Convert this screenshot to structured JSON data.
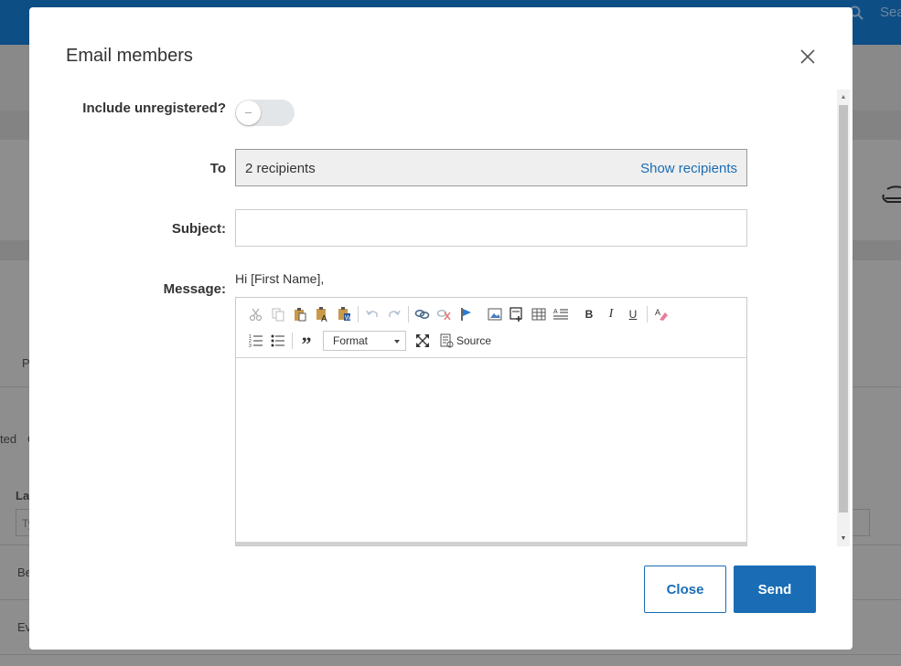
{
  "background": {
    "search_text": "Sea",
    "tab_fragment": "P",
    "filter_fragment_1": "ted",
    "filter_fragment_2": "C",
    "column_fragment": "Las",
    "input_fragment": "Ty",
    "row1_fragment": "Be",
    "row2_fragment": "Ev"
  },
  "modal": {
    "title": "Email members",
    "include_unregistered_label": "Include unregistered?",
    "toggle_state": "off",
    "to_label": "To",
    "recipients_count": "2 recipients",
    "show_recipients_link": "Show recipients",
    "subject_label": "Subject:",
    "subject_value": "",
    "message_label": "Message:",
    "message_greeting": "Hi [First Name],",
    "editor": {
      "toolbar_row1": [
        "cut-icon",
        "copy-icon",
        "paste-icon",
        "paste-text-icon",
        "paste-word-icon",
        "undo-icon",
        "redo-icon",
        "link-icon",
        "unlink-icon",
        "anchor-icon",
        "image-icon",
        "embed-icon",
        "table-icon",
        "text-indent-icon",
        "bold",
        "italic",
        "underline",
        "remove-format-icon"
      ],
      "toolbar_row2": [
        "numbered-list-icon",
        "bullet-list-icon",
        "blockquote-icon",
        "format-dropdown",
        "maximize-icon",
        "source-icon"
      ],
      "bold_label": "B",
      "italic_label": "I",
      "underline_label": "U",
      "blockquote_label": "”",
      "format_label": "Format",
      "source_label": "Source",
      "body_text": ""
    },
    "close_button": "Close",
    "send_button": "Send"
  },
  "colors": {
    "primary": "#1a6db5",
    "overlay": "#8c8c8c",
    "topbar": "#0d4e85"
  }
}
